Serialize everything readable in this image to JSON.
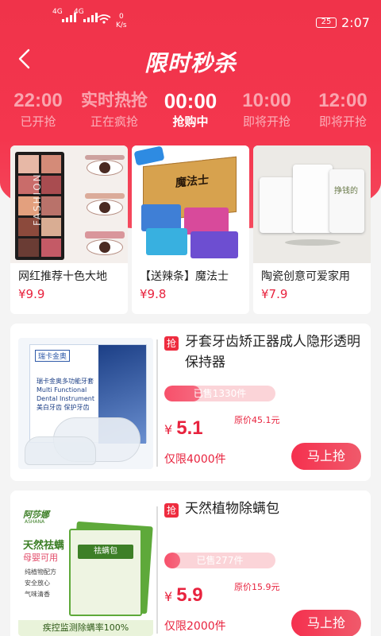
{
  "status_bar": {
    "signal1_label": "4G",
    "signal2_label": "4G",
    "speed_value": "0",
    "speed_unit": "K/s",
    "battery": "25",
    "time": "2:07"
  },
  "header": {
    "title": "限时秒杀"
  },
  "tabs": [
    {
      "time": "22:00",
      "status": "已开抢",
      "active": false
    },
    {
      "time": "实时热抢",
      "status": "正在疯抢",
      "active": false
    },
    {
      "time": "00:00",
      "status": "抢购中",
      "active": true
    },
    {
      "time": "10:00",
      "status": "即将开抢",
      "active": false
    },
    {
      "time": "12:00",
      "status": "即将开抢",
      "active": false
    }
  ],
  "top_products": [
    {
      "name": "网红推荐十色大地",
      "price": "¥9.9",
      "image": "eyeshadow-palette",
      "palette_text": "FASHION"
    },
    {
      "name": "【送辣条】魔法士",
      "price": "¥9.8",
      "image": "snack-box",
      "box_text": "魔法士"
    },
    {
      "name": "陶瓷创意可爱家用",
      "price": "¥7.9",
      "image": "ceramic-mugs",
      "mug_text": "挣钱的"
    }
  ],
  "list_products": [
    {
      "badge": "抢",
      "name": "牙套牙齿矫正器成人隐形透明保持器",
      "sold": "已售1330件",
      "sold_fraction": 0.33,
      "currency": "¥",
      "price": "5.1",
      "original": "原价45.1元",
      "limit": "仅限4000件",
      "button": "马上抢",
      "image_brand": "瑞卡金奥",
      "image_lines": [
        "瑞卡金奥多功能牙套",
        "Multi Functional",
        "Dental Instrument",
        "美白牙齿 保护牙齿"
      ]
    },
    {
      "badge": "抢",
      "name": "天然植物除螨包",
      "sold": "已售277件",
      "sold_fraction": 0.14,
      "currency": "¥",
      "price": "5.9",
      "original": "原价15.9元",
      "limit": "仅限2000件",
      "button": "马上抢",
      "image_brand": "阿莎娜",
      "image_brand_en": "ASHANA",
      "image_lines": [
        "天然祛螨",
        "母婴可用",
        "纯植物配方",
        "安全放心",
        "气味清香"
      ],
      "image_banner": "疾控监测除螨率100%"
    }
  ],
  "colors": {
    "brand": "#f0334a",
    "price": "#e8233e"
  }
}
